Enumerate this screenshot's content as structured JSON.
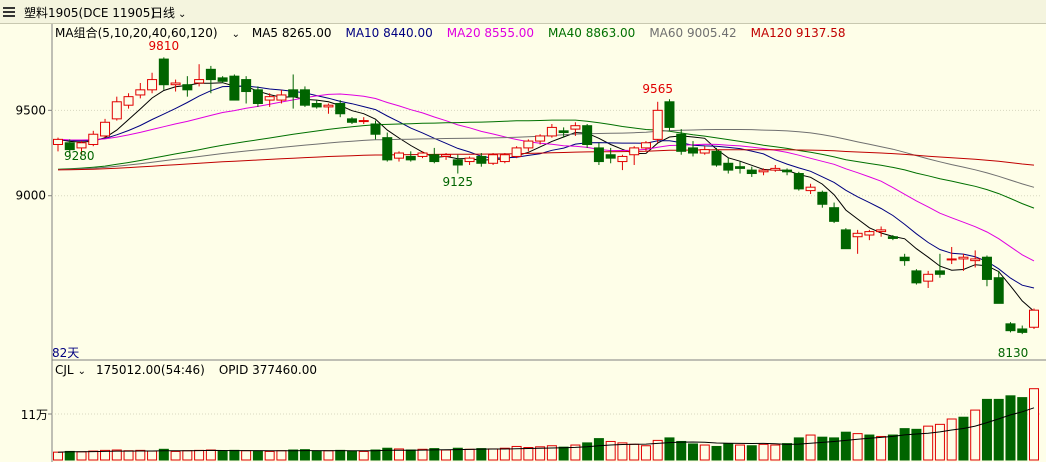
{
  "header": {
    "title": "塑料1905(DCE 11905)",
    "period_label": "日线",
    "period_chevron": "chevron-down-icon"
  },
  "ma_legend": {
    "group_label": "MA组合(5,10,20,40,60,120)",
    "items": [
      {
        "label": "MA5 8265.00",
        "color": "#000000"
      },
      {
        "label": "MA10 8440.00",
        "color": "#000080"
      },
      {
        "label": "MA20 8555.00",
        "color": "#e000e0"
      },
      {
        "label": "MA40 8863.00",
        "color": "#007000"
      },
      {
        "label": "MA60 9005.42",
        "color": "#707070"
      },
      {
        "label": "MA120 9137.58",
        "color": "#c00000"
      }
    ]
  },
  "price_axis": {
    "tick_labels": [
      "9500",
      "9000"
    ]
  },
  "annotations": {
    "high_label": "9810",
    "left_label": "9280",
    "low_mid_label": "9125",
    "peak_label": "9565",
    "low_label": "8130",
    "days_label": "82天"
  },
  "volume_panel": {
    "indicator": "CJL",
    "volume_value": "175012.00(54:46)",
    "opid_value": "OPID 377460.00",
    "axis_label": "11万"
  },
  "colors": {
    "up": "#e00000",
    "down": "#006400",
    "background": "#fefee8",
    "grid": "#d8d8c0"
  },
  "chart_data": {
    "type": "candlestick",
    "ylim": [
      8050,
      9900
    ],
    "candles": [
      [
        9300,
        9340,
        9260,
        9330
      ],
      [
        9310,
        9330,
        9250,
        9270
      ],
      [
        9280,
        9320,
        9240,
        9310
      ],
      [
        9300,
        9380,
        9290,
        9360
      ],
      [
        9350,
        9450,
        9340,
        9430
      ],
      [
        9450,
        9580,
        9440,
        9550
      ],
      [
        9530,
        9600,
        9510,
        9580
      ],
      [
        9590,
        9660,
        9570,
        9620
      ],
      [
        9620,
        9720,
        9600,
        9680
      ],
      [
        9800,
        9810,
        9620,
        9650
      ],
      [
        9650,
        9680,
        9610,
        9660
      ],
      [
        9650,
        9700,
        9580,
        9620
      ],
      [
        9660,
        9770,
        9640,
        9680
      ],
      [
        9740,
        9760,
        9600,
        9680
      ],
      [
        9690,
        9700,
        9660,
        9670
      ],
      [
        9700,
        9710,
        9580,
        9560
      ],
      [
        9680,
        9700,
        9540,
        9610
      ],
      [
        9620,
        9640,
        9520,
        9540
      ],
      [
        9560,
        9600,
        9520,
        9580
      ],
      [
        9560,
        9620,
        9540,
        9590
      ],
      [
        9620,
        9710,
        9510,
        9580
      ],
      [
        9620,
        9640,
        9520,
        9530
      ],
      [
        9540,
        9560,
        9510,
        9520
      ],
      [
        9520,
        9540,
        9480,
        9530
      ],
      [
        9540,
        9560,
        9460,
        9480
      ],
      [
        9450,
        9460,
        9420,
        9430
      ],
      [
        9440,
        9460,
        9420,
        9440
      ],
      [
        9420,
        9440,
        9330,
        9360
      ],
      [
        9340,
        9370,
        9200,
        9210
      ],
      [
        9220,
        9260,
        9200,
        9250
      ],
      [
        9230,
        9260,
        9200,
        9210
      ],
      [
        9230,
        9260,
        9220,
        9250
      ],
      [
        9240,
        9280,
        9190,
        9200
      ],
      [
        9230,
        9250,
        9210,
        9240
      ],
      [
        9210,
        9240,
        9130,
        9180
      ],
      [
        9200,
        9230,
        9180,
        9220
      ],
      [
        9230,
        9250,
        9170,
        9190
      ],
      [
        9190,
        9250,
        9180,
        9240
      ],
      [
        9200,
        9250,
        9190,
        9240
      ],
      [
        9230,
        9290,
        9220,
        9280
      ],
      [
        9280,
        9330,
        9260,
        9320
      ],
      [
        9320,
        9360,
        9300,
        9350
      ],
      [
        9350,
        9420,
        9340,
        9400
      ],
      [
        9380,
        9400,
        9340,
        9370
      ],
      [
        9390,
        9430,
        9350,
        9410
      ],
      [
        9410,
        9420,
        9280,
        9300
      ],
      [
        9280,
        9310,
        9180,
        9200
      ],
      [
        9240,
        9280,
        9190,
        9220
      ],
      [
        9200,
        9240,
        9150,
        9230
      ],
      [
        9240,
        9290,
        9180,
        9280
      ],
      [
        9280,
        9320,
        9260,
        9310
      ],
      [
        9330,
        9550,
        9310,
        9500
      ],
      [
        9550,
        9565,
        9380,
        9400
      ],
      [
        9360,
        9390,
        9240,
        9260
      ],
      [
        9280,
        9320,
        9230,
        9250
      ],
      [
        9250,
        9290,
        9240,
        9270
      ],
      [
        9260,
        9280,
        9170,
        9180
      ],
      [
        9190,
        9220,
        9130,
        9150
      ],
      [
        9170,
        9200,
        9130,
        9160
      ],
      [
        9150,
        9170,
        9110,
        9130
      ],
      [
        9140,
        9160,
        9120,
        9150
      ],
      [
        9150,
        9180,
        9140,
        9160
      ],
      [
        9150,
        9160,
        9120,
        9140
      ],
      [
        9130,
        9140,
        9030,
        9040
      ],
      [
        9030,
        9070,
        9010,
        9050
      ],
      [
        9020,
        9030,
        8930,
        8950
      ],
      [
        8930,
        8960,
        8840,
        8850
      ],
      [
        8800,
        8810,
        8710,
        8690
      ],
      [
        8760,
        8800,
        8660,
        8780
      ],
      [
        8770,
        8800,
        8740,
        8790
      ],
      [
        8790,
        8820,
        8760,
        8800
      ],
      [
        8760,
        8770,
        8740,
        8750
      ],
      [
        8640,
        8660,
        8590,
        8620
      ],
      [
        8560,
        8570,
        8480,
        8490
      ],
      [
        8500,
        8560,
        8460,
        8540
      ],
      [
        8560,
        8660,
        8520,
        8540
      ],
      [
        8630,
        8700,
        8600,
        8630
      ],
      [
        8630,
        8660,
        8560,
        8640
      ],
      [
        8620,
        8680,
        8580,
        8630
      ],
      [
        8640,
        8650,
        8470,
        8510
      ],
      [
        8520,
        8560,
        8400,
        8370
      ],
      [
        8250,
        8260,
        8200,
        8210
      ],
      [
        8220,
        8240,
        8190,
        8200
      ],
      [
        8230,
        8340,
        8220,
        8330
      ]
    ],
    "volume": [
      [
        22000,
        1
      ],
      [
        24000,
        0
      ],
      [
        23000,
        1
      ],
      [
        25000,
        1
      ],
      [
        27000,
        1
      ],
      [
        28000,
        1
      ],
      [
        26000,
        1
      ],
      [
        27000,
        1
      ],
      [
        25000,
        1
      ],
      [
        30000,
        0
      ],
      [
        24000,
        1
      ],
      [
        26000,
        1
      ],
      [
        27000,
        1
      ],
      [
        28000,
        1
      ],
      [
        25000,
        0
      ],
      [
        27000,
        0
      ],
      [
        26000,
        1
      ],
      [
        25000,
        0
      ],
      [
        24000,
        1
      ],
      [
        26000,
        1
      ],
      [
        28000,
        0
      ],
      [
        29000,
        0
      ],
      [
        25000,
        0
      ],
      [
        26000,
        1
      ],
      [
        27000,
        0
      ],
      [
        25000,
        0
      ],
      [
        24000,
        1
      ],
      [
        28000,
        0
      ],
      [
        33000,
        0
      ],
      [
        31000,
        1
      ],
      [
        28000,
        0
      ],
      [
        30000,
        1
      ],
      [
        32000,
        0
      ],
      [
        28000,
        1
      ],
      [
        33000,
        0
      ],
      [
        30000,
        1
      ],
      [
        32000,
        0
      ],
      [
        31000,
        1
      ],
      [
        33000,
        1
      ],
      [
        38000,
        1
      ],
      [
        35000,
        1
      ],
      [
        37000,
        1
      ],
      [
        40000,
        1
      ],
      [
        36000,
        0
      ],
      [
        42000,
        1
      ],
      [
        48000,
        0
      ],
      [
        60000,
        0
      ],
      [
        52000,
        1
      ],
      [
        48000,
        1
      ],
      [
        44000,
        1
      ],
      [
        40000,
        1
      ],
      [
        55000,
        1
      ],
      [
        62000,
        0
      ],
      [
        52000,
        0
      ],
      [
        45000,
        0
      ],
      [
        42000,
        1
      ],
      [
        38000,
        0
      ],
      [
        46000,
        0
      ],
      [
        42000,
        1
      ],
      [
        40000,
        0
      ],
      [
        44000,
        1
      ],
      [
        42000,
        1
      ],
      [
        46000,
        0
      ],
      [
        62000,
        0
      ],
      [
        70000,
        1
      ],
      [
        64000,
        0
      ],
      [
        62000,
        0
      ],
      [
        78000,
        0
      ],
      [
        74000,
        1
      ],
      [
        70000,
        0
      ],
      [
        66000,
        1
      ],
      [
        70000,
        0
      ],
      [
        88000,
        0
      ],
      [
        86000,
        0
      ],
      [
        95000,
        1
      ],
      [
        100000,
        1
      ],
      [
        115000,
        1
      ],
      [
        120000,
        0
      ],
      [
        140000,
        1
      ],
      [
        170000,
        0
      ],
      [
        170000,
        0
      ],
      [
        180000,
        0
      ],
      [
        175012,
        0
      ],
      [
        200000,
        1
      ]
    ]
  }
}
